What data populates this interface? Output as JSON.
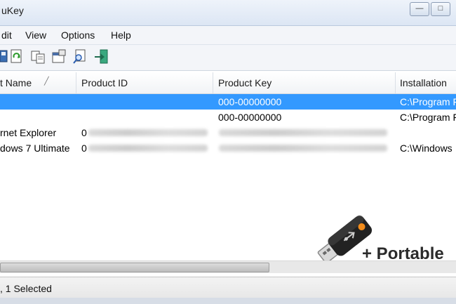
{
  "window": {
    "title": "uKey",
    "minimize_icon": "minimize-icon",
    "maximize_icon": "maximize-icon"
  },
  "menu": [
    "dit",
    "View",
    "Options",
    "Help"
  ],
  "toolbar": {
    "icons": [
      "save-icon",
      "refresh-icon",
      "copy-icon",
      "properties-icon",
      "find-icon",
      "exit-icon"
    ]
  },
  "columns": [
    "t Name",
    "Product ID",
    "Product Key",
    "Installation"
  ],
  "sort_indicator": "╱",
  "rows": [
    {
      "name": "",
      "product_id": "",
      "product_key": "000-00000000",
      "install": "C:\\Program F",
      "selected": true
    },
    {
      "name": "",
      "product_id": "",
      "product_key": "000-00000000",
      "install": "C:\\Program F",
      "selected": false
    },
    {
      "name": "rnet Explorer",
      "product_id": "0",
      "product_key": "",
      "install": "",
      "selected": false
    },
    {
      "name": "dows 7 Ultimate",
      "product_id": "0",
      "product_key": "",
      "install": "C:\\Windows",
      "selected": false
    }
  ],
  "status": {
    "text": ", 1 Selected"
  },
  "promo": {
    "text": "+ Portable"
  },
  "colors": {
    "selection": "#3399ff",
    "usb_body": "#222222",
    "usb_accent": "#f28c1b"
  }
}
